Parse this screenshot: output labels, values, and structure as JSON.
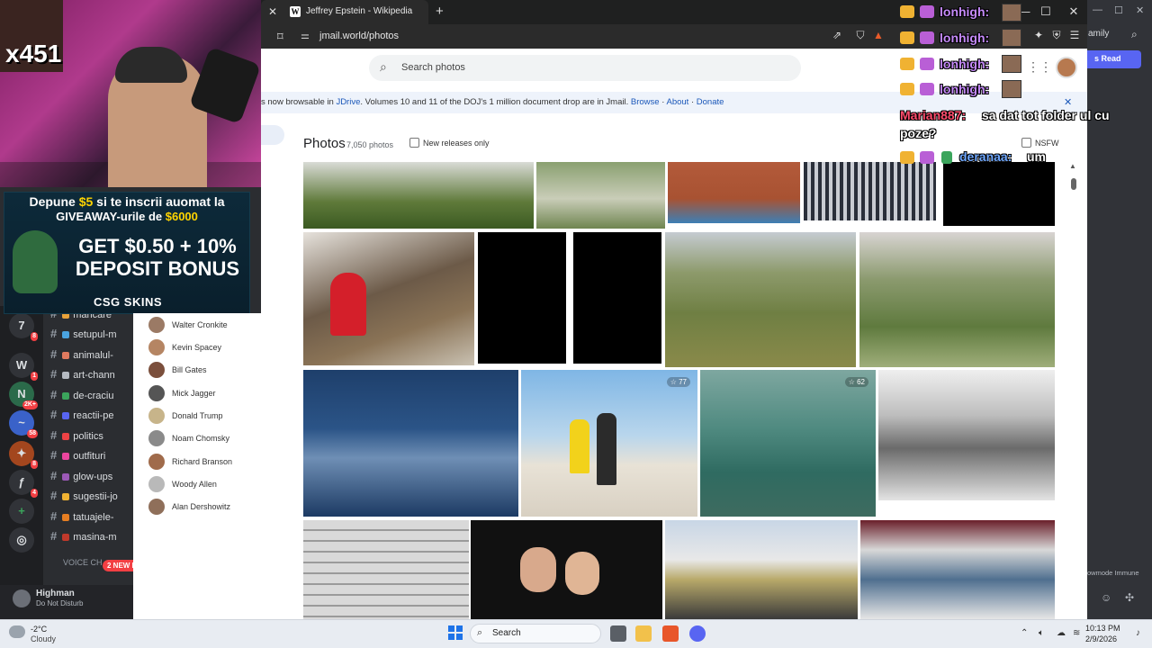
{
  "browser": {
    "tab_title": "Jeffrey Epstein - Wikipedia",
    "tab_favicon": "W",
    "url": "jmail.world/photos"
  },
  "page": {
    "search_placeholder": "Search photos",
    "banner": {
      "text": "s now browsable in JDrive. Volumes 10 and 11 of the DOJ's 1 million document drop are in Jmail.",
      "jdrive": "JDrive",
      "pre": "s now browsable in ",
      "post": ". Volumes 10 and 11 of the DOJ's 1 million document drop are in Jmail.",
      "browse": "Browse",
      "about": "About",
      "donate": "Donate",
      "sep": "·"
    },
    "photos_title": "Photos",
    "photos_count": "7,050 photos",
    "new_releases_label": "New releases only",
    "nsfw_label": "NSFW",
    "star_counts": [
      "77",
      "62"
    ],
    "people": [
      "Walter Cronkite",
      "Kevin Spacey",
      "Bill Gates",
      "Mick Jagger",
      "Donald Trump",
      "Noam Chomsky",
      "Richard Branson",
      "Woody Allen",
      "Alan Dershowitz"
    ]
  },
  "stream": {
    "viewer_count": "x451",
    "ad": {
      "line1_pre": "Depune ",
      "line1_amount": "$5",
      "line1_post": " si te inscrii auomat la",
      "line2_pre": "GIVEAWAY-urile de ",
      "line2_amount": "$6000",
      "line3": "GET $0.50 + 10%",
      "line4": "DEPOSIT BONUS",
      "brand": "CSG SKINS"
    },
    "chat": [
      {
        "user": "lonhigh:",
        "color": "#c58af9"
      },
      {
        "user": "lonhigh:",
        "color": "#c58af9"
      },
      {
        "user": "lonhigh:",
        "color": "#c58af9"
      },
      {
        "user": "lonhigh:",
        "color": "#c58af9"
      },
      {
        "user": "Marian887:",
        "color": "#ff4d6d",
        "message": "sa dat tot folder ul cu poze?"
      },
      {
        "user": "deranaa:",
        "color": "#6fa8ff",
        "message": "um"
      }
    ],
    "chat_message_line2": "poze?",
    "chat_message_line1": "sa dat tot folder ul cu"
  },
  "discord": {
    "channels": [
      {
        "name": "mancare",
        "emoji_color": "#e8a23a"
      },
      {
        "name": "setupul-m",
        "emoji_color": "#4aa3df"
      },
      {
        "name": "animalul-",
        "emoji_color": "#e07a5f"
      },
      {
        "name": "art-chann",
        "emoji_color": "#b5bac1"
      },
      {
        "name": "de-craciu",
        "emoji_color": "#3ba55c"
      },
      {
        "name": "reactii-pe",
        "emoji_color": "#5865f2"
      },
      {
        "name": "politics",
        "emoji_color": "#ed4245"
      },
      {
        "name": "outfituri",
        "emoji_color": "#eb459e"
      },
      {
        "name": "glow-ups",
        "emoji_color": "#9b59b6"
      },
      {
        "name": "sugestii-jo",
        "emoji_color": "#f0b232"
      },
      {
        "name": "tatuajele-",
        "emoji_color": "#e67e22"
      },
      {
        "name": "masina-m",
        "emoji_color": "#c0392b"
      }
    ],
    "voice_header": "VOICE CH",
    "new_mentions": "2 NEW M",
    "user_name": "Highman",
    "user_status": "Do Not Disturb",
    "right_family": "amily",
    "right_read": "s Read",
    "right_slowmode": "owmode Immune",
    "server_badges": [
      "8",
      "1",
      "2K+",
      "58",
      "8",
      "4"
    ]
  },
  "taskbar": {
    "weather_temp": "-2°C",
    "weather_desc": "Cloudy",
    "search_label": "Search",
    "time": "10:13 PM",
    "date": "2/9/2026"
  }
}
